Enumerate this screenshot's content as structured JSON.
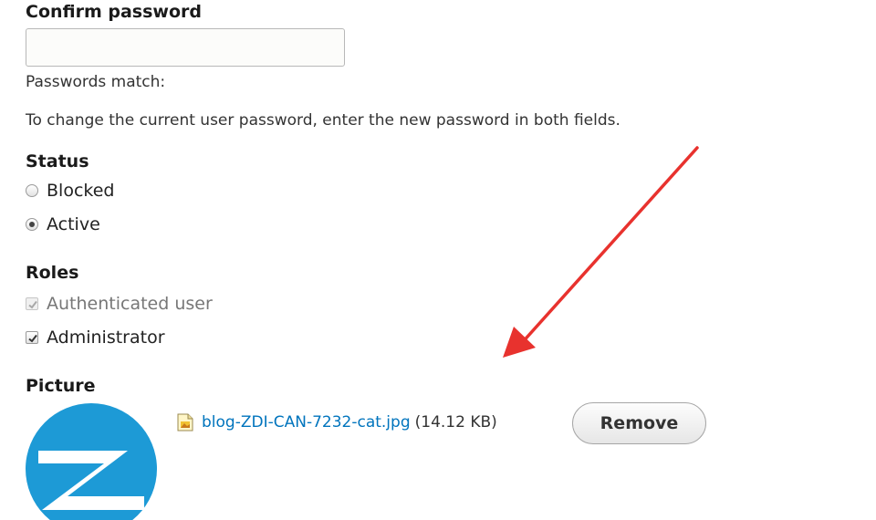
{
  "confirm_password": {
    "label": "Confirm password",
    "value": "",
    "placeholder": "",
    "match_text": "Passwords match:"
  },
  "description": "To change the current user password, enter the new password in both fields.",
  "status": {
    "label": "Status",
    "options": [
      {
        "label": "Blocked",
        "checked": false
      },
      {
        "label": "Active",
        "checked": true
      }
    ]
  },
  "roles": {
    "label": "Roles",
    "options": [
      {
        "label": "Authenticated user",
        "checked": true,
        "disabled": true
      },
      {
        "label": "Administrator",
        "checked": true,
        "disabled": false
      }
    ]
  },
  "picture": {
    "label": "Picture",
    "file_name": "blog-ZDI-CAN-7232-cat.jpg",
    "file_size": "(14.12 KB)",
    "remove_label": "Remove",
    "file_icon": "image-file-icon",
    "avatar": "zdi-logo-avatar"
  },
  "colors": {
    "link": "#0074bd",
    "avatar_blue": "#1d9ad6",
    "annotation_arrow": "#e8322e"
  }
}
